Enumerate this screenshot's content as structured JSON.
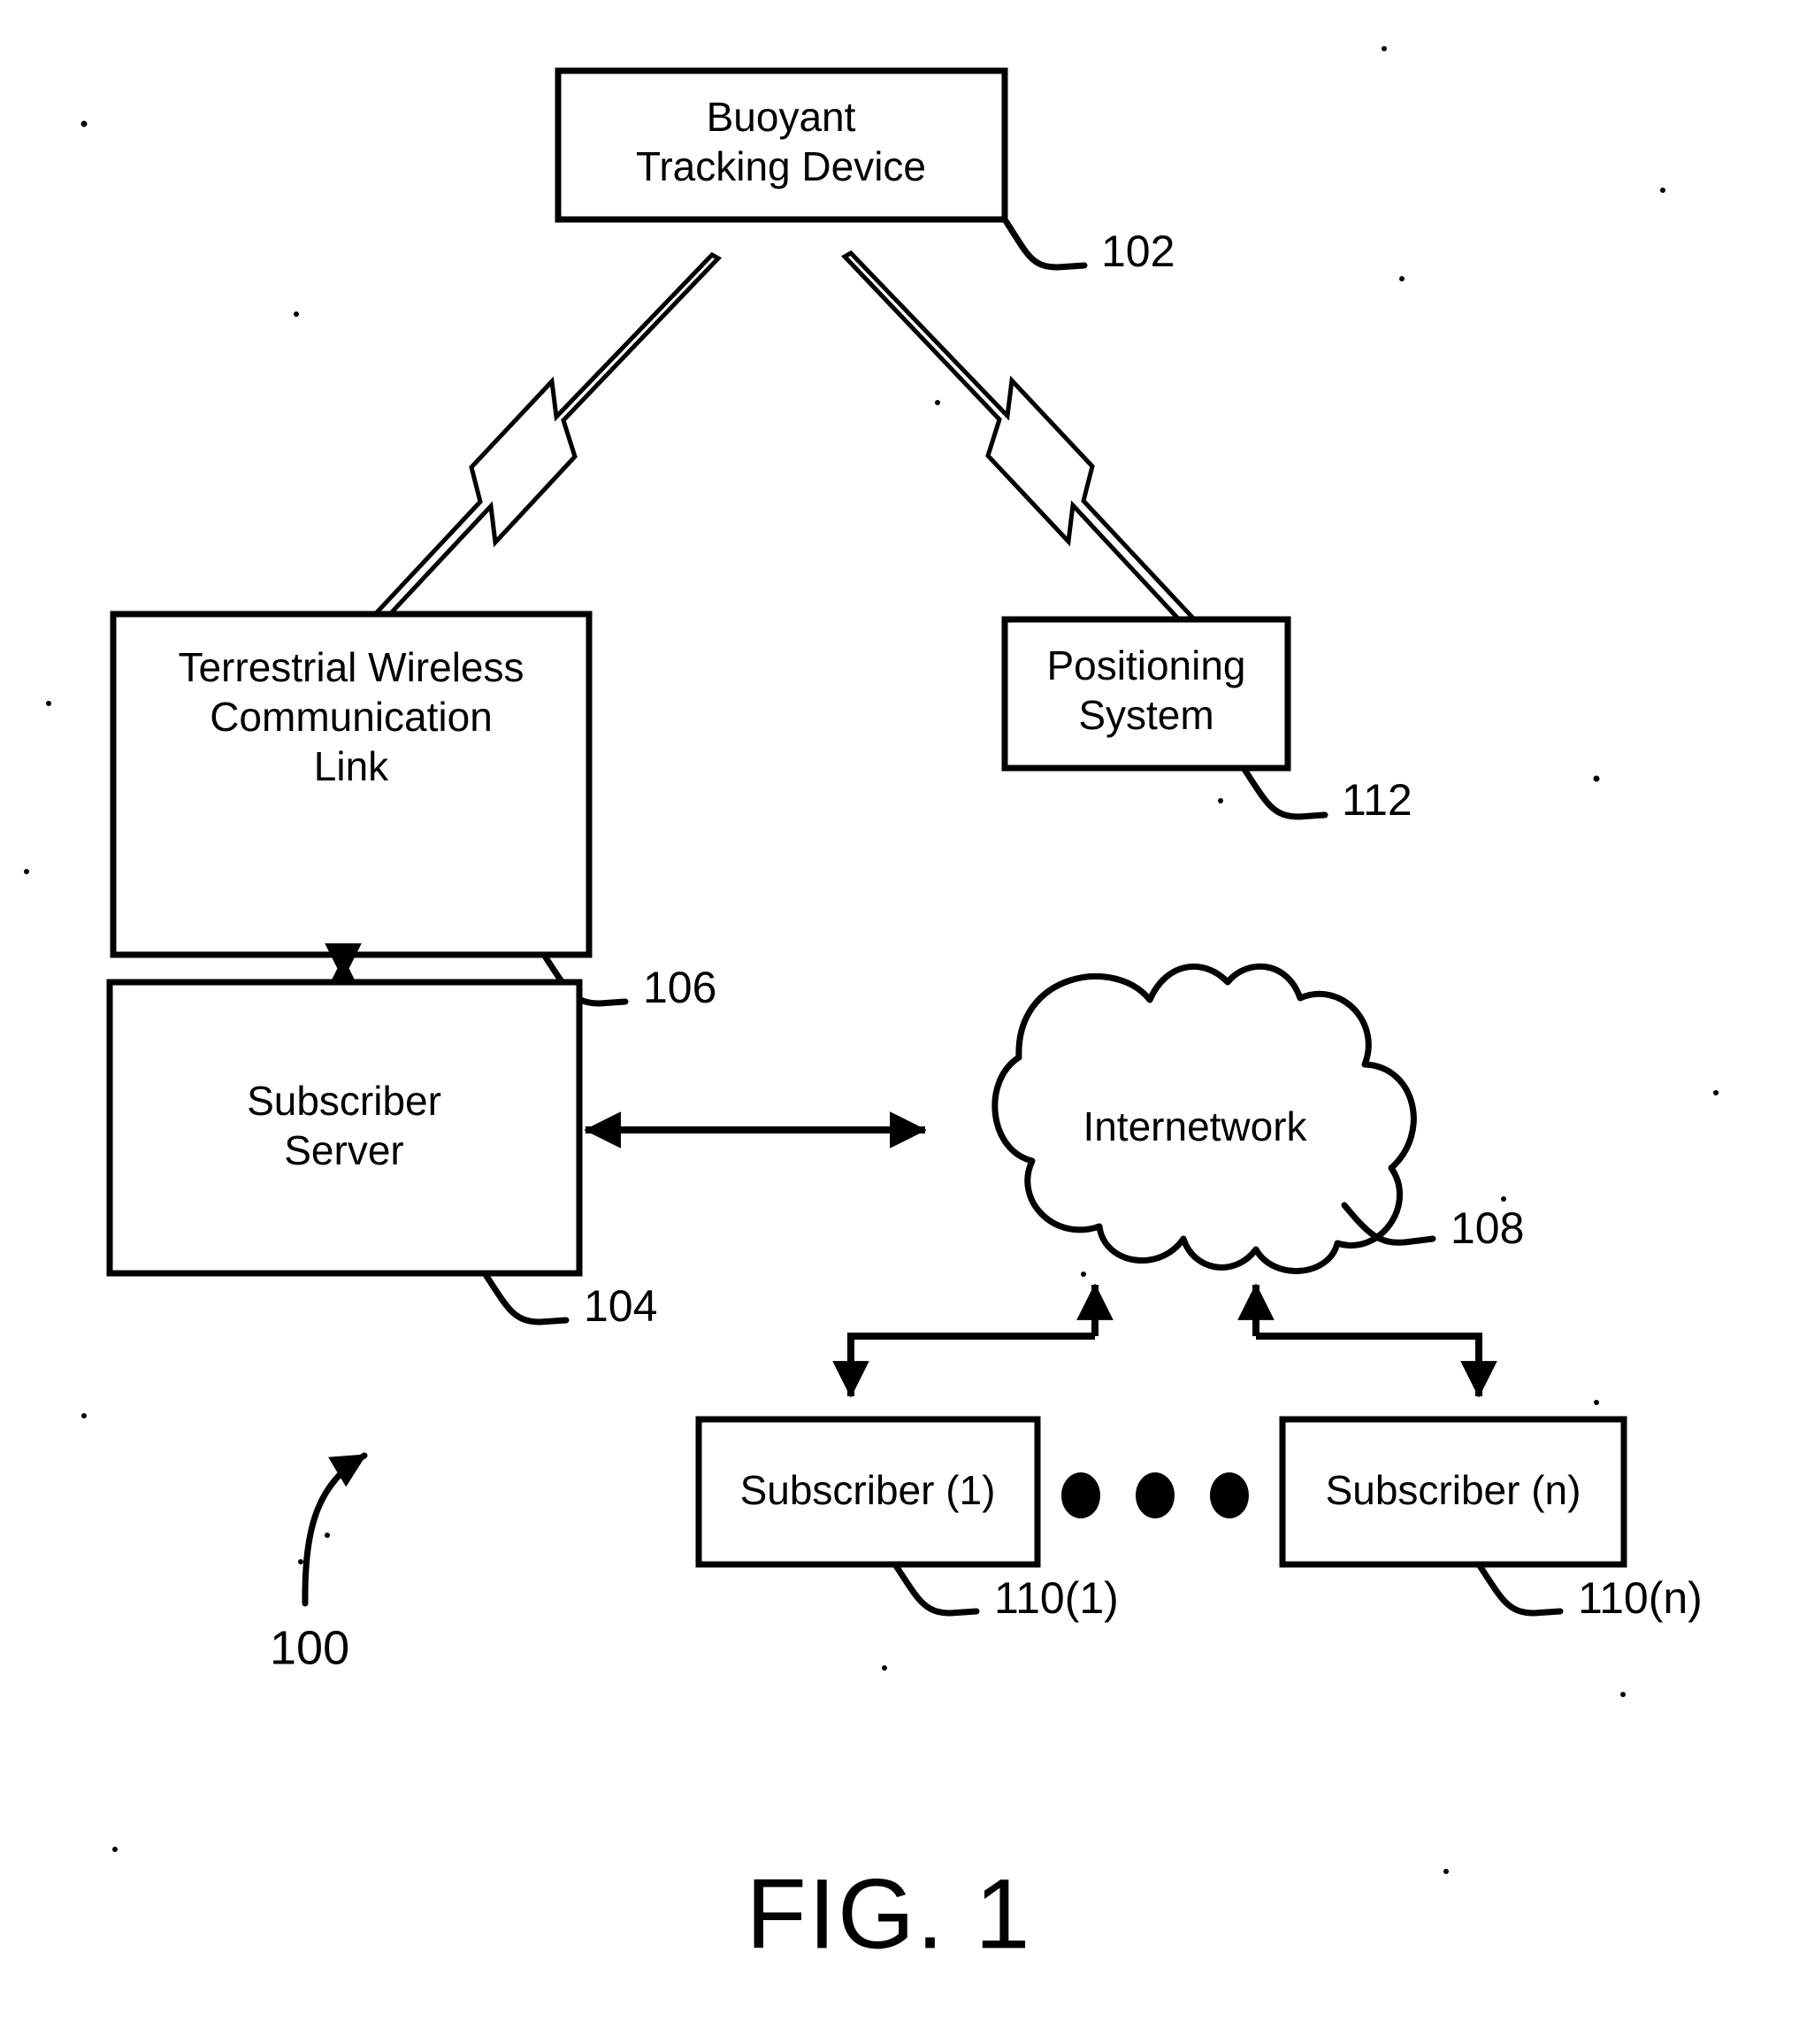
{
  "figure": {
    "caption": "FIG. 1",
    "system_ref": "100"
  },
  "nodes": {
    "buoyant_tracking_device": {
      "line1": "Buoyant",
      "line2": "Tracking Device",
      "ref": "102"
    },
    "terrestrial_wireless_link": {
      "line1": "Terrestrial Wireless",
      "line2": "Communication",
      "line3": "Link",
      "ref": "106"
    },
    "positioning_system": {
      "line1": "Positioning",
      "line2": "System",
      "ref": "112"
    },
    "subscriber_server": {
      "line1": "Subscriber",
      "line2": "Server",
      "ref": "104"
    },
    "internetwork": {
      "label": "Internetwork",
      "ref": "108"
    },
    "subscriber_first": {
      "label": "Subscriber (1)",
      "ref": "110(1)"
    },
    "subscriber_nth": {
      "label": "Subscriber (n)",
      "ref": "110(n)"
    }
  },
  "connectors": {
    "bolt_left_name": "wireless-bolt-left",
    "bolt_right_name": "wireless-bolt-right",
    "link_to_server": "bidirectional-vertical-arrow",
    "server_to_internetwork": "bidirectional-horizontal-arrow",
    "internetwork_to_subscriber1": "arrow-pair-left",
    "internetwork_to_subscribern": "arrow-pair-right"
  },
  "ellipsis": {
    "dot_count": 3
  }
}
